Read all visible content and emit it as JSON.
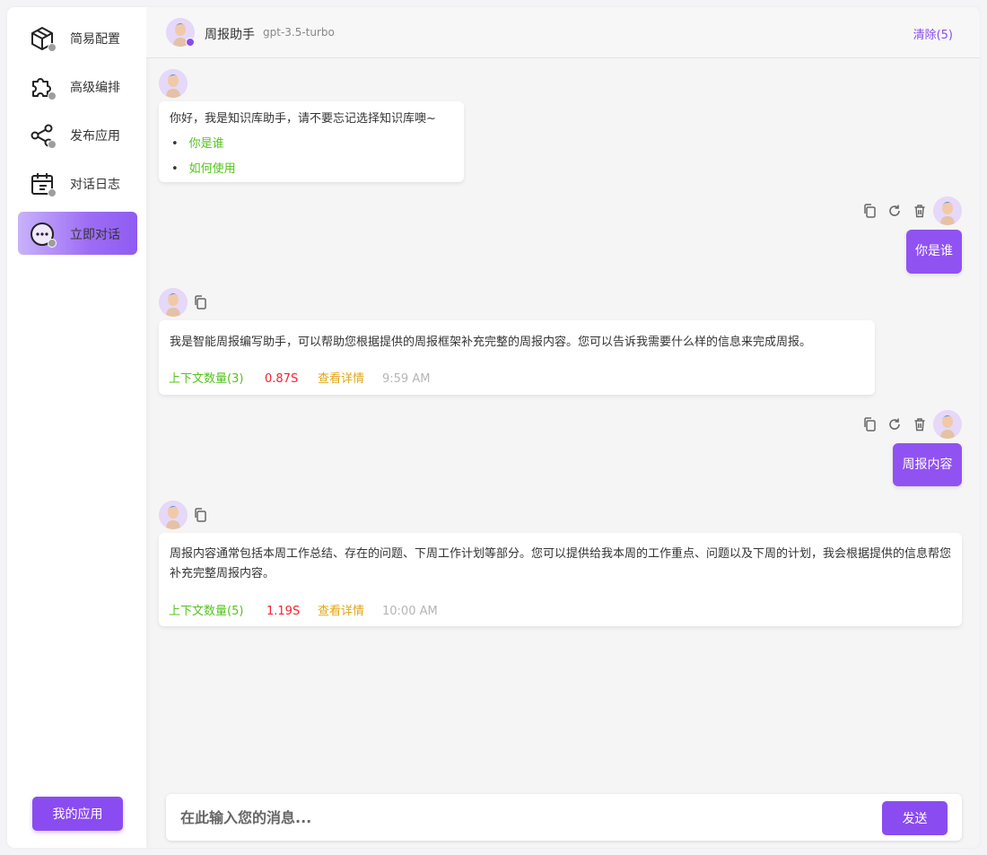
{
  "sidebar": {
    "items": [
      {
        "label": "简易配置",
        "icon": "cube-icon"
      },
      {
        "label": "高级编排",
        "icon": "puzzle-icon"
      },
      {
        "label": "发布应用",
        "icon": "share-icon"
      },
      {
        "label": "对话日志",
        "icon": "calendar-log-icon"
      },
      {
        "label": "立即对话",
        "icon": "chat-bubble-icon",
        "active": true
      }
    ],
    "my_apps_label": "我的应用"
  },
  "header": {
    "bot_name": "周报助手",
    "model": "gpt-3.5-turbo",
    "clear_label": "清除(5)"
  },
  "messages": [
    {
      "role": "bot",
      "text": "你好，我是知识库助手，请不要忘记选择知识库噢~",
      "suggestions": [
        "你是谁",
        "如何使用"
      ]
    },
    {
      "role": "user",
      "text": "你是谁"
    },
    {
      "role": "bot",
      "text": "我是智能周报编写助手，可以帮助您根据提供的周报框架补充完整的周报内容。您可以告诉我需要什么样的信息来完成周报。",
      "context": "上下文数量(3)",
      "duration": "0.87S",
      "detail": "查看详情",
      "time": "9:59 AM"
    },
    {
      "role": "user",
      "text": "周报内容"
    },
    {
      "role": "bot",
      "text": "周报内容通常包括本周工作总结、存在的问题、下周工作计划等部分。您可以提供给我本周的工作重点、问题以及下周的计划，我会根据提供的信息帮您补充完整周报内容。",
      "context": "上下文数量(5)",
      "duration": "1.19S",
      "detail": "查看详情",
      "time": "10:00 AM"
    }
  ],
  "input": {
    "placeholder": "在此输入您的消息...",
    "send_label": "发送"
  },
  "colors": {
    "accent": "#8a4cf0",
    "context_green": "#52c41a",
    "duration_red": "#f5222d",
    "detail_yellow": "#e0a514"
  }
}
